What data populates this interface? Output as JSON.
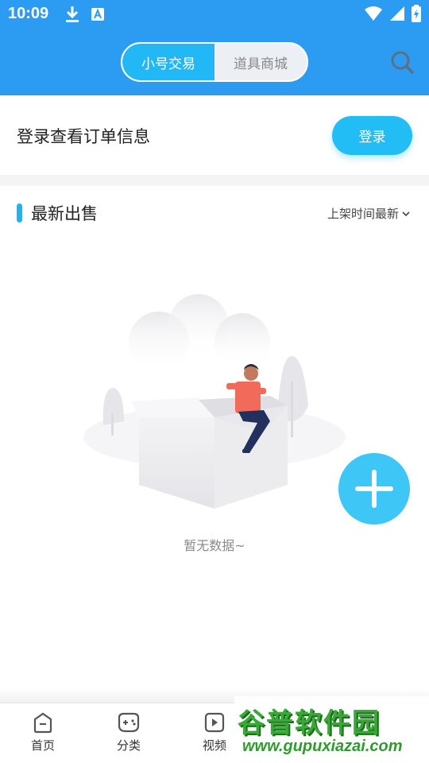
{
  "status_bar": {
    "time": "10:09"
  },
  "header": {
    "tabs": [
      {
        "label": "小号交易",
        "active": true
      },
      {
        "label": "道具商城",
        "active": false
      }
    ],
    "search_icon": "search-icon"
  },
  "login": {
    "prompt": "登录查看订单信息",
    "button_label": "登录"
  },
  "section": {
    "title": "最新出售",
    "sort_label": "上架时间最新"
  },
  "empty_state": {
    "message": "暂无数据~"
  },
  "fab_icon": "plus-icon",
  "bottom_nav": {
    "items": [
      {
        "label": "首页",
        "icon": "home-icon"
      },
      {
        "label": "分类",
        "icon": "gamepad-icon"
      },
      {
        "label": "视频",
        "icon": "video-icon"
      }
    ]
  },
  "watermark": {
    "title": "谷普软件园",
    "url": "www.gupuxiazai.com"
  },
  "colors": {
    "header_bg": "#2b9cf2",
    "accent": "#21b8f5",
    "fab": "#3ec6f6",
    "watermark": "#38a837"
  }
}
